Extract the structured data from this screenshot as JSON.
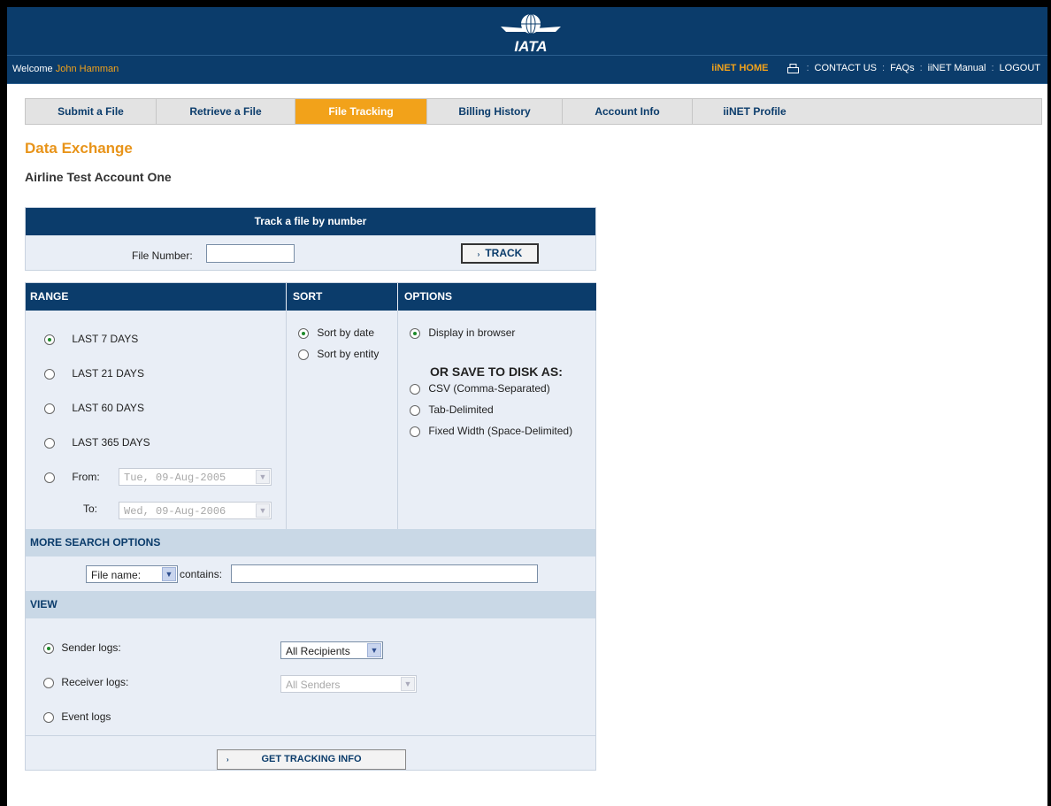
{
  "header": {
    "logo_text": "IATA",
    "welcome_prefix": "Welcome",
    "user_name": "John Hamman",
    "links": {
      "home": "iiNET HOME",
      "contact": "CONTACT US",
      "faqs": "FAQs",
      "manual": "iiNET Manual",
      "logout": "LOGOUT"
    },
    "sep": ":"
  },
  "nav": {
    "tabs": [
      {
        "label": "Submit a File"
      },
      {
        "label": "Retrieve a File"
      },
      {
        "label": "File Tracking",
        "active": true
      },
      {
        "label": "Billing History"
      },
      {
        "label": "Account Info"
      },
      {
        "label": "iiNET Profile"
      }
    ]
  },
  "page": {
    "title": "Data Exchange",
    "subtitle": "Airline Test Account One"
  },
  "track": {
    "heading": "Track a file by number",
    "field_label": "File Number:",
    "field_value": "",
    "button": "TRACK"
  },
  "range": {
    "heading": "RANGE",
    "options": [
      "LAST 7 DAYS",
      "LAST 21 DAYS",
      "LAST 60 DAYS",
      "LAST 365 DAYS"
    ],
    "selected": "LAST 7 DAYS",
    "from_label": "From:",
    "to_label": "To:",
    "from_value": "Tue, 09-Aug-2005",
    "to_value": "Wed, 09-Aug-2006"
  },
  "sort": {
    "heading": "SORT",
    "by_date": "Sort by date",
    "by_entity": "Sort by entity",
    "selected": "Sort by date"
  },
  "options": {
    "heading": "OPTIONS",
    "display": "Display in browser",
    "save_heading": "OR SAVE TO DISK AS:",
    "csv": "CSV (Comma-Separated)",
    "tab": "Tab-Delimited",
    "fixed": "Fixed Width (Space-Delimited)",
    "selected": "Display in browser"
  },
  "more_search": {
    "heading": "MORE SEARCH OPTIONS",
    "field_select": "File name:",
    "contains_label": "contains:",
    "contains_value": ""
  },
  "view": {
    "heading": "VIEW",
    "sender": "Sender logs:",
    "receiver": "Receiver logs:",
    "event": "Event logs",
    "recipients_select": "All Recipients",
    "senders_select": "All Senders",
    "selected": "Sender logs:"
  },
  "submit": {
    "button": "GET TRACKING INFO"
  },
  "colors": {
    "navy": "#0b3c6b",
    "accent": "#f2a21a"
  }
}
